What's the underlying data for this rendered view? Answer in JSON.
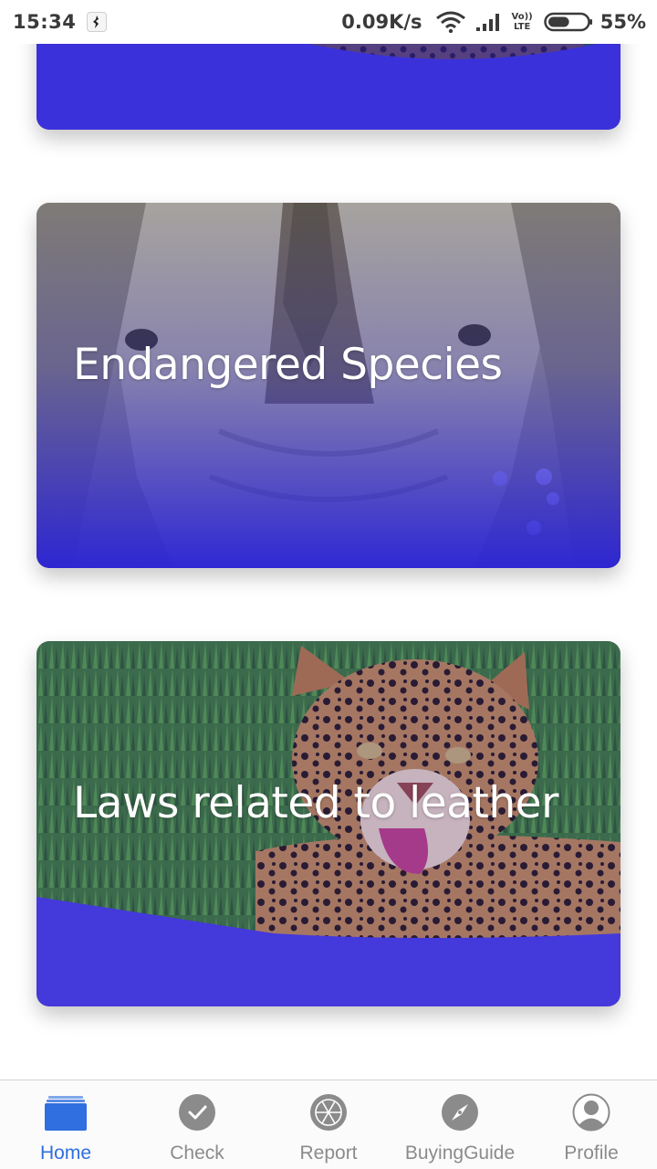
{
  "status_bar": {
    "time": "15:34",
    "network_speed": "0.09K/s",
    "lte_top": "Vo))",
    "lte_bottom": "LTE",
    "battery_percent": "55%",
    "battery_level": 0.55,
    "icons": [
      "notification-icon",
      "wifi-icon",
      "signal-icon",
      "battery-icon"
    ]
  },
  "cards": [
    {
      "title": "",
      "image": "leopard-photo-partial"
    },
    {
      "title": "Endangered Species",
      "image": "rhino-photo"
    },
    {
      "title": "Laws related to leather",
      "image": "leopard-photo"
    }
  ],
  "theme": {
    "overlay_color": "#2a22d6",
    "active_color": "#2f6fe0",
    "inactive_color": "#8b8b8b"
  },
  "bottom_nav": {
    "active": "Home",
    "items": [
      {
        "label": "Home",
        "icon": "home-icon"
      },
      {
        "label": "Check",
        "icon": "check-icon"
      },
      {
        "label": "Report",
        "icon": "report-icon"
      },
      {
        "label": "BuyingGuide",
        "icon": "compass-icon"
      },
      {
        "label": "Profile",
        "icon": "profile-icon"
      }
    ]
  }
}
